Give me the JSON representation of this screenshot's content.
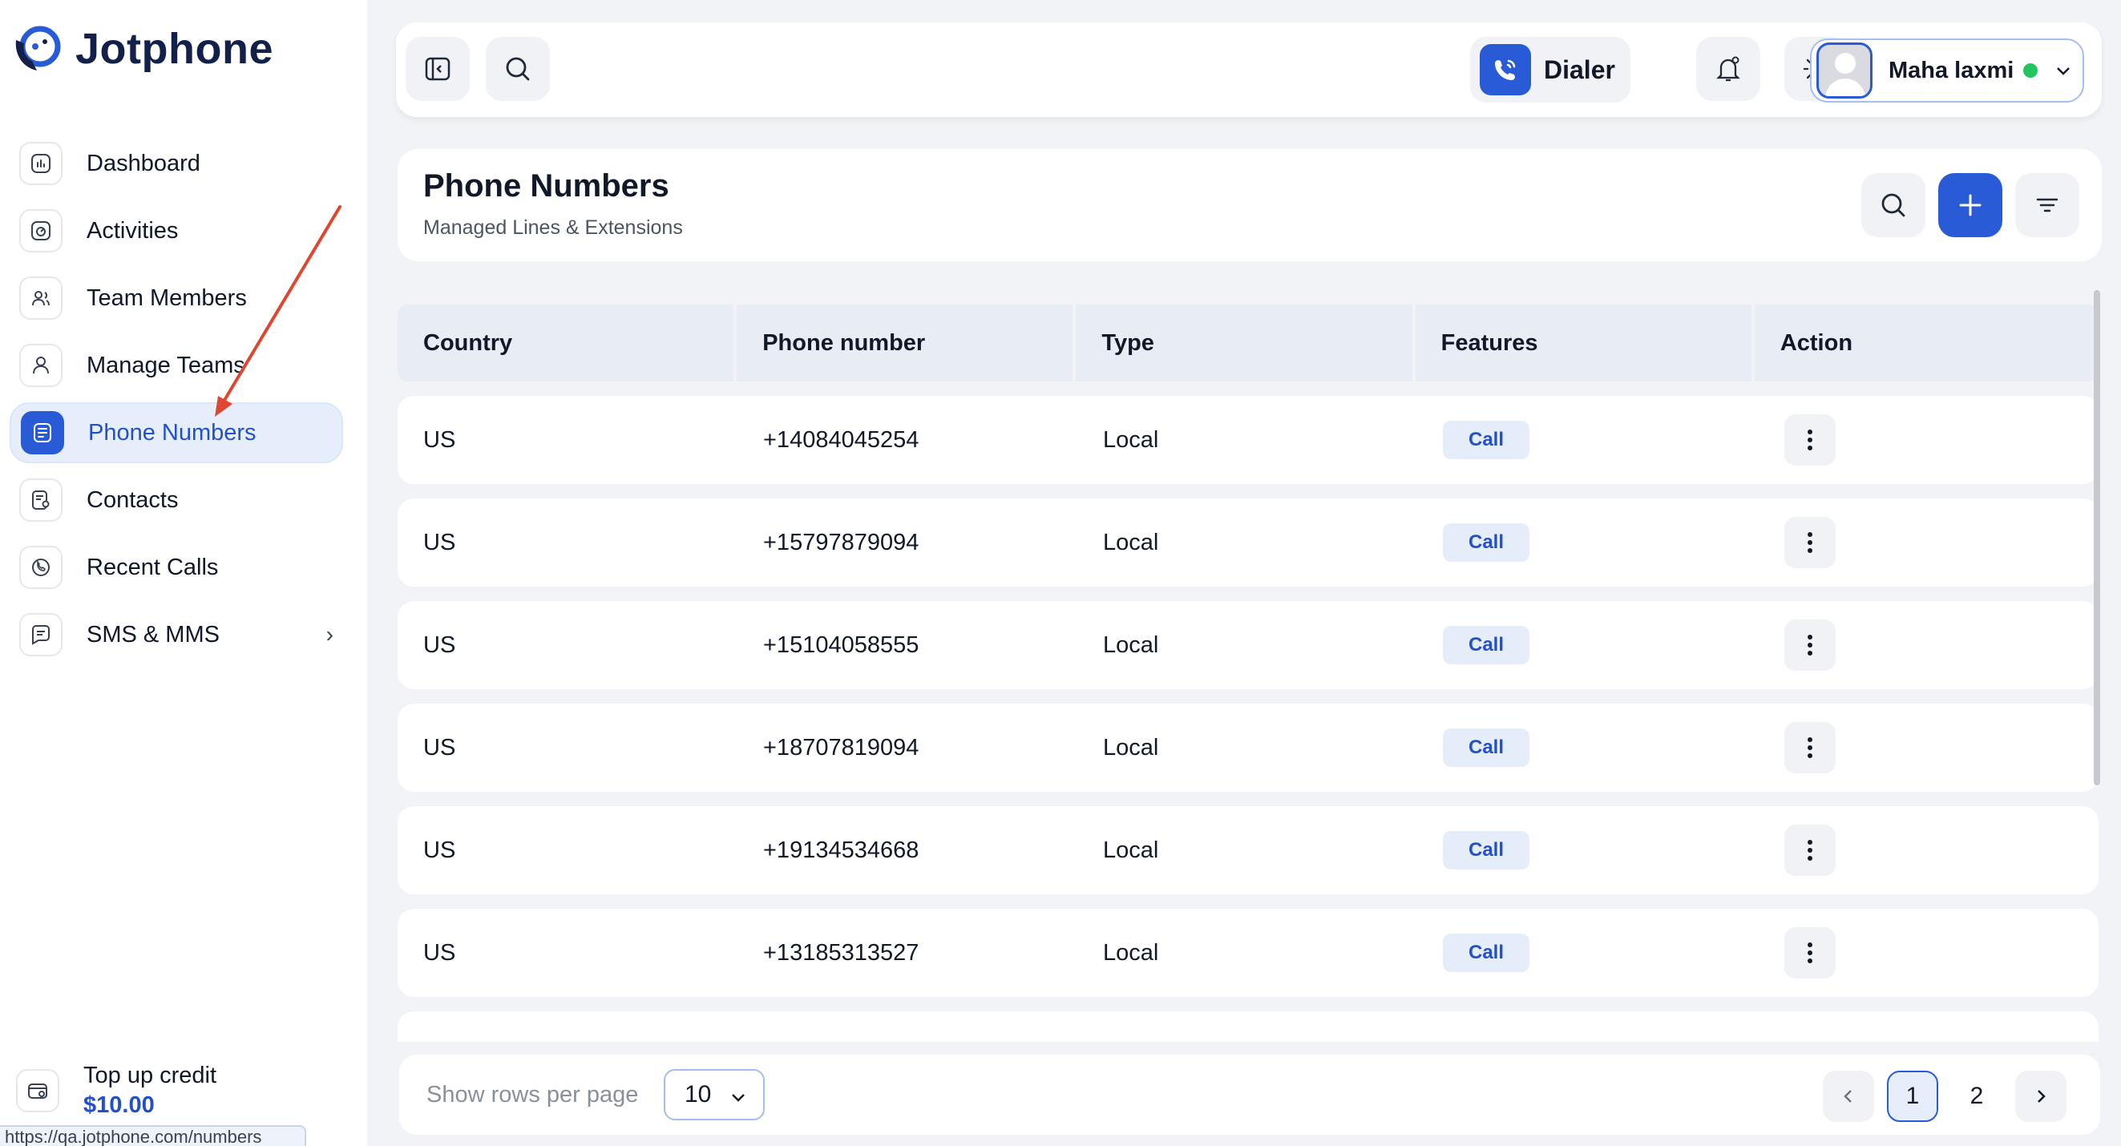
{
  "app": {
    "brand": "Jotphone",
    "accent_color": "#2a5bd7",
    "status_url": "https://qa.jotphone.com/numbers"
  },
  "sidebar": {
    "items": [
      {
        "label": "Dashboard",
        "icon": "dashboard-icon"
      },
      {
        "label": "Activities",
        "icon": "activities-icon"
      },
      {
        "label": "Team Members",
        "icon": "team-members-icon"
      },
      {
        "label": "Manage Teams",
        "icon": "manage-teams-icon"
      },
      {
        "label": "Phone Numbers",
        "icon": "phone-numbers-icon",
        "active": true
      },
      {
        "label": "Contacts",
        "icon": "contacts-icon"
      },
      {
        "label": "Recent Calls",
        "icon": "recent-calls-icon"
      },
      {
        "label": "SMS & MMS",
        "icon": "sms-icon",
        "has_submenu": true
      }
    ],
    "topup": {
      "title": "Top up credit",
      "amount": "$10.00"
    }
  },
  "topbar": {
    "dialer_label": "Dialer",
    "user": {
      "name": "Maha laxmi",
      "status": "online",
      "status_color": "#22c55e"
    }
  },
  "page": {
    "title": "Phone Numbers",
    "subtitle": "Managed Lines & Extensions"
  },
  "table": {
    "columns": [
      "Country",
      "Phone number",
      "Type",
      "Features",
      "Action"
    ],
    "rows": [
      {
        "country": "US",
        "phone": "+14084045254",
        "type": "Local",
        "feature": "Call"
      },
      {
        "country": "US",
        "phone": "+15797879094",
        "type": "Local",
        "feature": "Call"
      },
      {
        "country": "US",
        "phone": "+15104058555",
        "type": "Local",
        "feature": "Call"
      },
      {
        "country": "US",
        "phone": "+18707819094",
        "type": "Local",
        "feature": "Call"
      },
      {
        "country": "US",
        "phone": "+19134534668",
        "type": "Local",
        "feature": "Call"
      },
      {
        "country": "US",
        "phone": "+13185313527",
        "type": "Local",
        "feature": "Call"
      }
    ]
  },
  "footer": {
    "rows_label": "Show rows per page",
    "rows_value": "10",
    "pages": [
      "1",
      "2"
    ],
    "current_page": "1"
  }
}
